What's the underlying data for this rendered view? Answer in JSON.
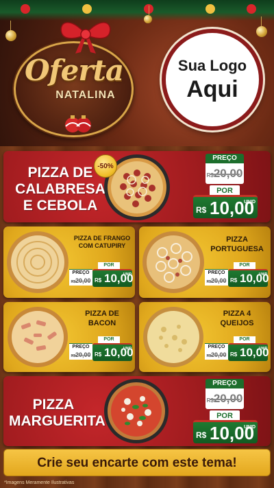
{
  "header": {
    "offer_title": "Oferta",
    "offer_subtitle": "NATALINA",
    "logo_line1": "Sua Logo",
    "logo_line2": "Aqui"
  },
  "currency": "R$",
  "products": [
    {
      "name_line1": "PIZZA DE",
      "name_line2": "CALABRESA",
      "name_line3": "E CEBOLA",
      "discount": "-50%",
      "preco_label": "PREÇO",
      "old_price": "20,00",
      "por_label": "POR",
      "new_price": "10,00",
      "unit": "UNID"
    },
    {
      "name_line1": "PIZZA DE FRANGO",
      "name_line2": "COM CATUPIRY",
      "preco_label": "PREÇO",
      "old_price": "20,00",
      "por_label": "POR",
      "new_price": "10,00",
      "unit": "UNID"
    },
    {
      "name_line1": "PIZZA",
      "name_line2": "PORTUGUESA",
      "preco_label": "PREÇO",
      "old_price": "20,00",
      "por_label": "POR",
      "new_price": "10,00",
      "unit": "UNID"
    },
    {
      "name_line1": "PIZZA DE",
      "name_line2": "BACON",
      "preco_label": "PREÇO",
      "old_price": "20,00",
      "por_label": "POR",
      "new_price": "10,00",
      "unit": "UNID"
    },
    {
      "name_line1": "PIZZA 4",
      "name_line2": "QUEIJOS",
      "preco_label": "PREÇO",
      "old_price": "20,00",
      "por_label": "POR",
      "new_price": "10,00",
      "unit": "UNID"
    },
    {
      "name_line1": "PIZZA",
      "name_line2": "MARGUERITA",
      "preco_label": "PREÇO",
      "old_price": "20,00",
      "por_label": "POR",
      "new_price": "10,00",
      "unit": "UNID"
    }
  ],
  "cta_text": "Crie seu encarte com este tema!",
  "disclaimer": "*Imagens Meramente Ilustrativas",
  "colors": {
    "red_card": "#a11c1f",
    "gold_card": "#e0a81d",
    "price_green": "#1c6e2c",
    "wood": "#6b3417"
  }
}
